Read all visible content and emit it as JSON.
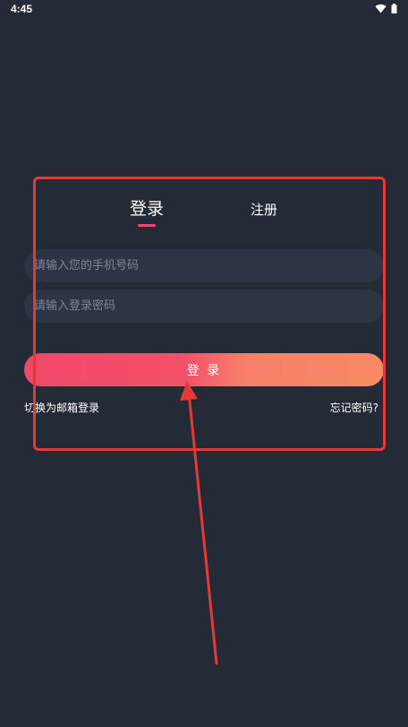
{
  "status_bar": {
    "time": "4:45",
    "icons": [
      "wifi-icon",
      "battery-icon"
    ]
  },
  "tabs": {
    "login_label": "登录",
    "register_label": "注册",
    "active": "login"
  },
  "form": {
    "phone_placeholder": "请输入您的手机号码",
    "password_placeholder": "请输入登录密码",
    "login_button_label": "登 录"
  },
  "links": {
    "switch_email": "切换为邮箱登录",
    "forgot_password": "忘记密码?"
  },
  "colors": {
    "background": "#252a37",
    "input_background": "#2f3445",
    "accent": "#f3476a",
    "button_gradient_start": "#f24767",
    "button_gradient_end": "#f98a66",
    "annotation_red": "#e53935"
  }
}
